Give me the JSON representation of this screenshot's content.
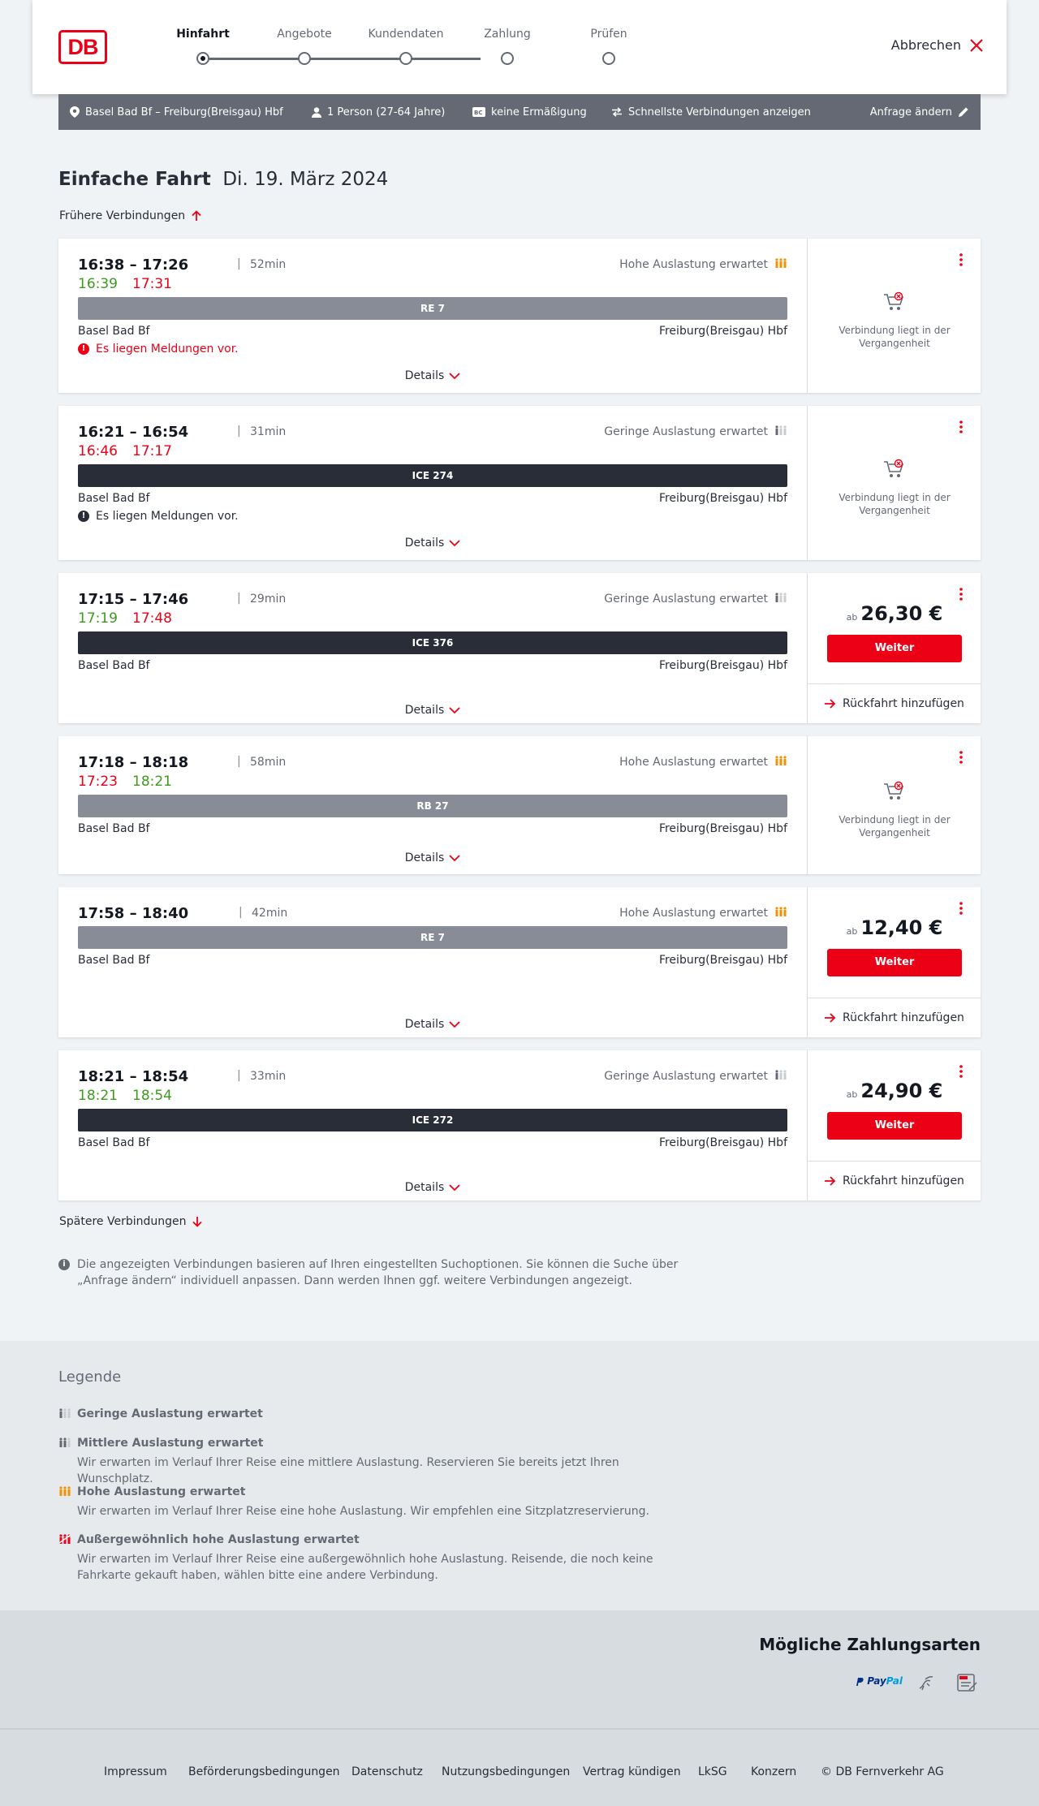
{
  "header": {
    "logo": "DB",
    "steps": [
      "Hinfahrt",
      "Angebote",
      "Kundendaten",
      "Zahlung",
      "Prüfen"
    ],
    "active_step": "Hinfahrt",
    "cancel_label": "Abbrechen"
  },
  "summary": {
    "route": "Basel Bad Bf – Freiburg(Breisgau) Hbf",
    "persons": "1 Person (27-64 Jahre)",
    "discount": "keine Ermäßigung",
    "fastest": "Schnellste Verbindungen anzeigen",
    "change": "Anfrage ändern"
  },
  "title": {
    "type": "Einfache Fahrt",
    "date": "Di. 19. März 2024"
  },
  "earlier": "Frühere Verbindungen",
  "later": "Spätere Verbindungen",
  "details_label": "Details",
  "past_text": "Verbindung liegt in der Vergangenheit",
  "ab_label": "ab",
  "weiter_label": "Weiter",
  "return_label": "Rückfahrt hinzufügen",
  "connections": [
    {
      "times": "16:38 – 17:26",
      "duration": "52min",
      "load": "Hohe Auslastung erwartet",
      "rt_dep": "16:39",
      "rt_arr": "17:31",
      "train": "RE 7",
      "from": "Basel Bad Bf",
      "to": "Freiburg(Breisgau) Hbf",
      "message": "Es liegen Meldungen vor.",
      "message_color": "red",
      "status": "past"
    },
    {
      "times": "16:21 – 16:54",
      "duration": "31min",
      "load": "Geringe Auslastung erwartet",
      "rt_dep": "16:46",
      "rt_arr": "17:17",
      "train": "ICE 274",
      "from": "Basel Bad Bf",
      "to": "Freiburg(Breisgau) Hbf",
      "message": "Es liegen Meldungen vor.",
      "message_color": "dark",
      "status": "past"
    },
    {
      "times": "17:15 – 17:46",
      "duration": "29min",
      "load": "Geringe Auslastung erwartet",
      "rt_dep": "17:19",
      "rt_arr": "17:48",
      "train": "ICE 376",
      "from": "Basel Bad Bf",
      "to": "Freiburg(Breisgau) Hbf",
      "price": "26,30 €",
      "status": "bookable"
    },
    {
      "times": "17:18 – 18:18",
      "duration": "58min",
      "load": "Hohe Auslastung erwartet",
      "rt_dep": "17:23",
      "rt_arr": "18:21",
      "train": "RB 27",
      "from": "Basel Bad Bf",
      "to": "Freiburg(Breisgau) Hbf",
      "status": "past"
    },
    {
      "times": "17:58 – 18:40",
      "duration": "42min",
      "load": "Hohe Auslastung erwartet",
      "train": "RE 7",
      "from": "Basel Bad Bf",
      "to": "Freiburg(Breisgau) Hbf",
      "price": "12,40 €",
      "status": "bookable"
    },
    {
      "times": "18:21 – 18:54",
      "duration": "33min",
      "load": "Geringe Auslastung erwartet",
      "rt_dep": "18:21",
      "rt_arr": "18:54",
      "train": "ICE 272",
      "from": "Basel Bad Bf",
      "to": "Freiburg(Breisgau) Hbf",
      "price": "24,90 €",
      "status": "bookable"
    }
  ],
  "info_text": "Die angezeigten Verbindungen basieren auf Ihren eingestellten Suchoptionen. Sie können die Suche über „Anfrage ändern“ individuell anpassen. Dann werden Ihnen ggf. weitere Verbindungen angezeigt.",
  "legend": {
    "title": "Legende",
    "items": [
      {
        "title": "Geringe Auslastung erwartet",
        "desc": ""
      },
      {
        "title": "Mittlere Auslastung erwartet",
        "desc": "Wir erwarten im Verlauf Ihrer Reise eine mittlere Auslastung. Reservieren Sie bereits jetzt Ihren Wunschplatz."
      },
      {
        "title": "Hohe Auslastung erwartet",
        "desc": "Wir erwarten im Verlauf Ihrer Reise eine hohe Auslastung. Wir empfehlen eine Sitzplatzreservierung."
      },
      {
        "title": "Außergewöhnlich hohe Auslastung erwartet",
        "desc": "Wir erwarten im Verlauf Ihrer Reise eine außergewöhnlich hohe Auslastung. Reisende, die noch keine Fahrkarte gekauft haben, wählen bitte eine andere Verbindung."
      }
    ]
  },
  "payment": {
    "title": "Mögliche Zahlungsarten",
    "paypal": "PayPal",
    "sepa": "SEPA"
  },
  "footer": [
    "Impressum",
    "Beförderungsbedingungen",
    "Datenschutz",
    "Nutzungsbedingungen",
    "Vertrag kündigen",
    "LkSG",
    "Konzern",
    "© DB Fernverkehr AG"
  ],
  "colors": {
    "accent": "#ec0016",
    "on_time": "#3c9a1c",
    "high_load": "#f39200",
    "dark": "#282d37"
  }
}
